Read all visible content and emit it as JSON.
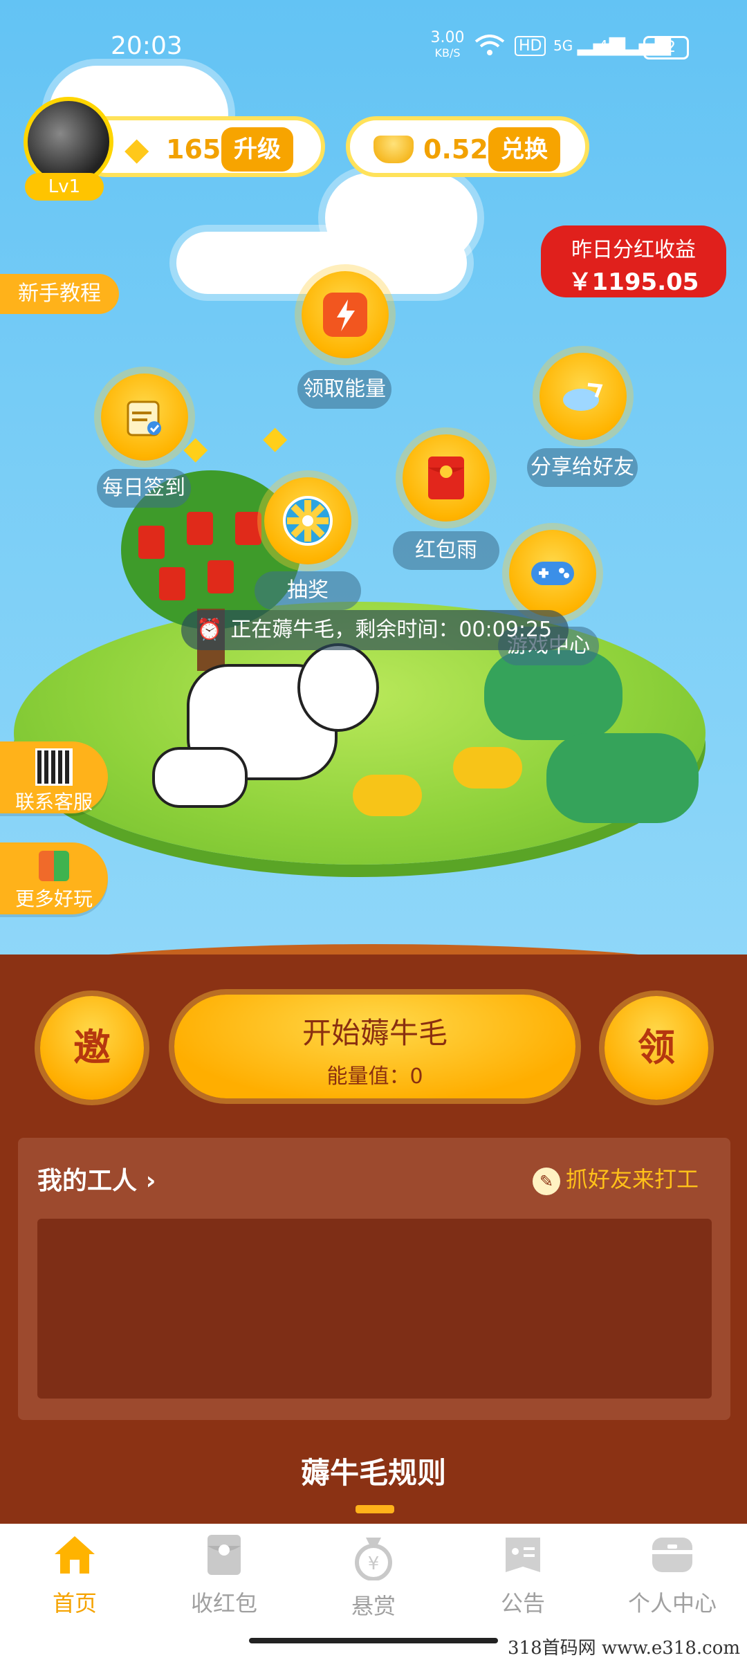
{
  "status_bar": {
    "time": "20:03",
    "net_speed": "3.00",
    "net_unit": "KB/S",
    "hd": "HD",
    "sig1": "5G",
    "sig2": "4G",
    "battery": "82"
  },
  "header": {
    "level": "Lv1",
    "diamond_count": "165",
    "upgrade_label": "升级",
    "gold_value": "0.52",
    "exchange_label": "兑换"
  },
  "dividend": {
    "title": "昨日分红收益",
    "amount": "￥1195.05"
  },
  "side": {
    "tutorial": "新手教程",
    "contact": "联系客服",
    "more": "更多好玩"
  },
  "activities": {
    "energy": "领取能量",
    "checkin": "每日签到",
    "share": "分享给好友",
    "lottery": "抽奖",
    "red_rain": "红包雨",
    "games": "游戏中心"
  },
  "timer_text": "正在薅牛毛，剩余时间：00:09:25",
  "actions": {
    "invite": "邀",
    "start_title": "开始薅牛毛",
    "energy_label": "能量值：0",
    "claim": "领"
  },
  "workers": {
    "title": "我的工人",
    "catch_friends": "抓好友来打工"
  },
  "rules_title": "薅牛毛规则",
  "tabs": [
    {
      "label": "首页",
      "icon": "home-icon"
    },
    {
      "label": "收红包",
      "icon": "red-envelope-icon"
    },
    {
      "label": "悬赏",
      "icon": "money-bag-icon"
    },
    {
      "label": "公告",
      "icon": "notice-icon"
    },
    {
      "label": "个人中心",
      "icon": "profile-icon"
    }
  ],
  "watermark": "318首码网 www.e318.com",
  "colors": {
    "accent": "#f5a300",
    "panel": "#8b3214",
    "sky": "#63c3f4",
    "dividend_red": "#e0201c"
  }
}
